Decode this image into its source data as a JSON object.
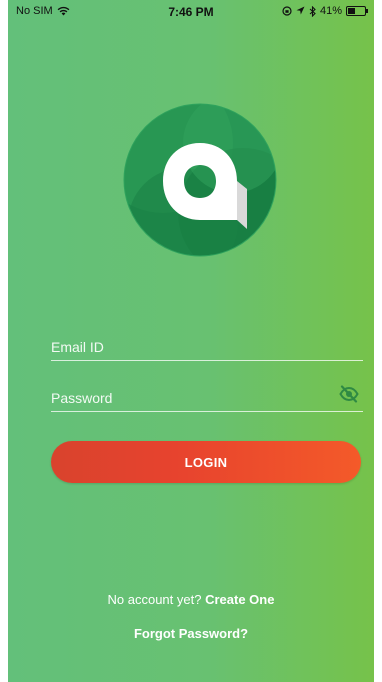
{
  "status_bar": {
    "carrier": "No SIM",
    "time": "7:46 PM",
    "battery_percent": "41%",
    "battery_level": 0.41
  },
  "logo": {
    "name": "app-logo-a"
  },
  "form": {
    "email_placeholder": "Email ID",
    "password_placeholder": "Password",
    "password_visibility_icon": "eye-off-icon"
  },
  "login_button_label": "LOGIN",
  "signup": {
    "prompt": "No account yet?",
    "link": "Create One"
  },
  "forgot_password": "Forgot Password?",
  "colors": {
    "background_start": "#63c07a",
    "background_end": "#76c24a",
    "button_start": "#d9432d",
    "button_end": "#f45a29",
    "text": "#ffffff"
  }
}
